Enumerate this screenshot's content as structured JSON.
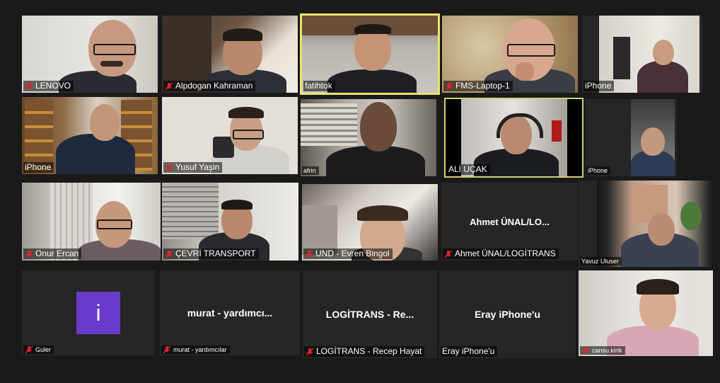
{
  "participants": [
    {
      "name": "LENOVO",
      "muted": true
    },
    {
      "name": "Alpdogan Kahraman",
      "muted": true
    },
    {
      "name": "fatihtok",
      "muted": false,
      "active_speaker": true
    },
    {
      "name": "FMS-Laptop-1",
      "muted": true
    },
    {
      "name": "iPhone",
      "muted": false
    },
    {
      "name": "iPhone",
      "muted": false
    },
    {
      "name": "Yusuf Yaşin",
      "muted": true
    },
    {
      "name": "afrin",
      "muted": false
    },
    {
      "name": "ALİ UÇAK",
      "muted": false
    },
    {
      "name": "iPhone",
      "muted": false
    },
    {
      "name": "Onur Ercan",
      "muted": true
    },
    {
      "name": "ÇEVRİ TRANSPORT",
      "muted": true
    },
    {
      "name": "UND - Evren Bingol",
      "muted": true
    },
    {
      "name": "Ahmet ÜNAL/LOGİTRANS",
      "muted": true,
      "display_text": "Ahmet  ÜNAL/LO..."
    },
    {
      "name": "Yavuz Uluser",
      "muted": false
    },
    {
      "name": "Guler",
      "muted": true,
      "avatar_letter": "i"
    },
    {
      "name": "murat - yardımcılar",
      "muted": true,
      "display_text": "murat - yardımcı..."
    },
    {
      "name": "LOGİTRANS - Recep Hayat",
      "muted": true,
      "display_text": "LOGİTRANS - Re..."
    },
    {
      "name": "Eray iPhone'u",
      "muted": false,
      "display_text": "Eray iPhone'u"
    },
    {
      "name": "cansu.kirik",
      "muted": true
    }
  ],
  "colors": {
    "background": "#1a1a1a",
    "tile": "#262626",
    "active_speaker_border": "#e8e46b",
    "muted_icon": "#e0252a",
    "avatar": "#6a3aca"
  }
}
